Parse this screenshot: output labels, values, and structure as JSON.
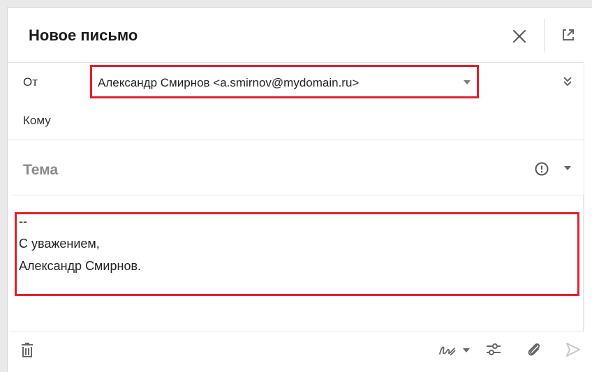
{
  "window": {
    "title": "Новое письмо"
  },
  "header": {
    "close_icon": "close-icon",
    "popout_icon": "open-in-new-window-icon"
  },
  "from": {
    "label": "От",
    "value": "Александр Смирнов <a.smirnov@mydomain.ru>"
  },
  "to": {
    "label": "Кому",
    "value": ""
  },
  "subject": {
    "placeholder": "Тема",
    "value": ""
  },
  "signature": {
    "lines": [
      "--",
      "С уважением,",
      "Александр Смирнов."
    ]
  },
  "footer": {
    "icons": [
      "trash-icon",
      "signature-icon",
      "settings-sliders-icon",
      "paperclip-icon",
      "send-icon"
    ]
  },
  "colors": {
    "highlight": "#e0202a",
    "icon": "#666666",
    "send_disabled": "#c8c8c8"
  }
}
